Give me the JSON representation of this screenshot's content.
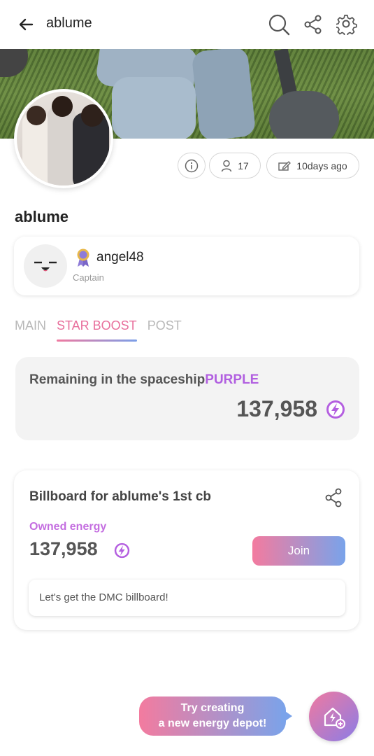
{
  "header": {
    "title": "ablume",
    "icons": [
      "back-arrow-icon",
      "search-icon",
      "share-icon",
      "gear-icon"
    ]
  },
  "stats": {
    "members": "17",
    "created": "10days ago"
  },
  "group": {
    "name": "ablume"
  },
  "captain": {
    "name": "angel48",
    "role": "Captain"
  },
  "tabs": [
    {
      "label": "MAIN",
      "active": false
    },
    {
      "label": "STAR BOOST",
      "active": true
    },
    {
      "label": "POST",
      "active": false
    }
  ],
  "remaining": {
    "label": "Remaining in the spaceship",
    "ship": "PURPLE",
    "value": "137,958"
  },
  "billboard": {
    "title": "Billboard for ablume's 1st cb",
    "owned_label": "Owned energy",
    "owned_value": "137,958",
    "join_label": "Join",
    "message": "Let's get the DMC billboard!"
  },
  "promo": {
    "line1": "Try creating",
    "line2": "a new energy depot!"
  },
  "colors": {
    "accent_pink": "#e86f9c",
    "accent_blue": "#7b9fe8",
    "ship_purple": "#b15fe0"
  }
}
